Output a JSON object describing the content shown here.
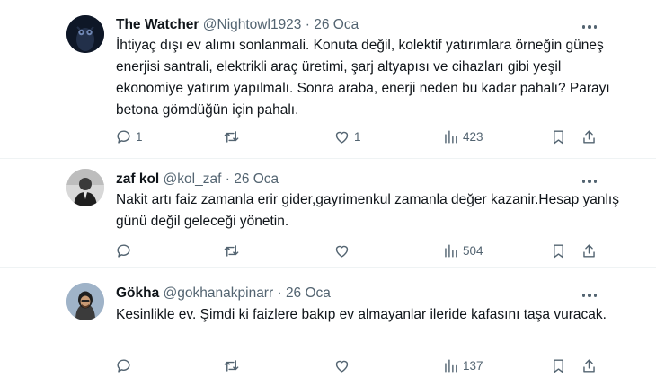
{
  "tweets": [
    {
      "name": "The Watcher",
      "handle": "@Nightowl1923",
      "dot": "·",
      "date": "26 Oca",
      "text": "İhtiyaç dışı ev alımı sonlanmali. Konuta değil, kolektif yatırımlara örneğin güneş enerjisi santrali, elektrikli araç üretimi, şarj altyapısı ve cihazları gibi yeşil ekonomiye yatırım yapılmalı. Sonra araba, enerji neden bu kadar pahalı? Parayı betona gömdüğün için pahalı.",
      "replies": "1",
      "retweets": "",
      "likes": "1",
      "views": "423"
    },
    {
      "name": "zaf kol",
      "handle": "@kol_zaf",
      "dot": "·",
      "date": "26 Oca",
      "text": "Nakit artı faiz zamanla erir gider,gayrimenkul zamanla değer kazanir.Hesap yanlış günü değil geleceği yönetin.",
      "replies": "",
      "retweets": "",
      "likes": "",
      "views": "504"
    },
    {
      "name": "Gökha",
      "handle": "@gokhanakpinarr",
      "dot": "·",
      "date": "26 Oca",
      "text": "Kesinlikle ev. Şimdi ki faizlere bakıp ev almayanlar ileride kafasını taşa vuracak.",
      "replies": "",
      "retweets": "",
      "likes": "",
      "views": "137"
    }
  ],
  "icons": {
    "reply": "reply-icon",
    "retweet": "retweet-icon",
    "like": "heart-icon",
    "views": "views-icon",
    "bookmark": "bookmark-icon",
    "share": "share-icon",
    "more": "more-icon"
  },
  "colors": {
    "text": "#0f1419",
    "secondary": "#536471",
    "divider": "#eff3f4"
  }
}
